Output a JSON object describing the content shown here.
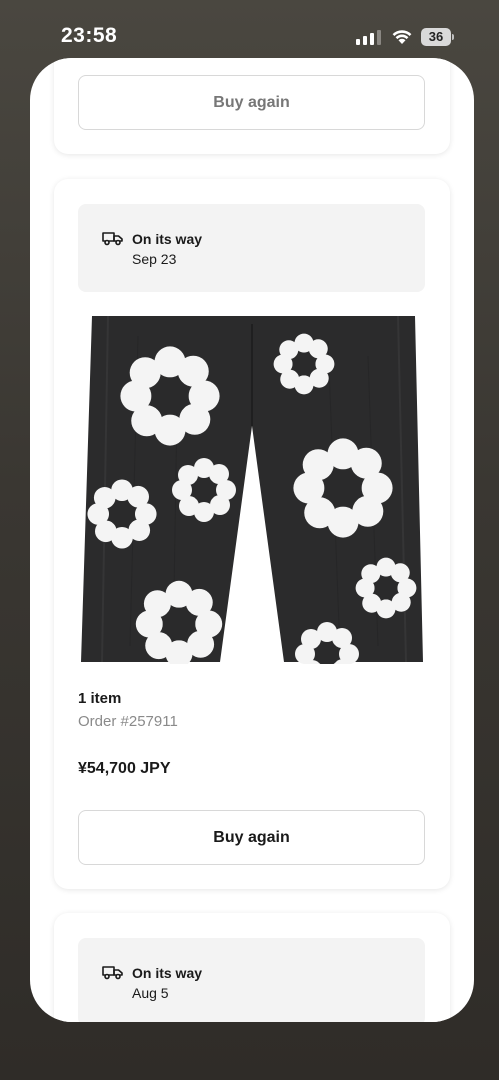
{
  "status_bar": {
    "time": "23:58",
    "battery": "36"
  },
  "orders": [
    {
      "buy_again_label": "Buy again"
    },
    {
      "status": "On its way",
      "date": "Sep 23",
      "item_count": "1 item",
      "order_number": "Order #257911",
      "price": "¥54,700 JPY",
      "buy_again_label": "Buy again",
      "image": "black-denim-jeans-white-flower-print"
    },
    {
      "status": "On its way",
      "date": "Aug 5"
    }
  ],
  "icons": {
    "delivery": "delivery-truck-icon"
  }
}
